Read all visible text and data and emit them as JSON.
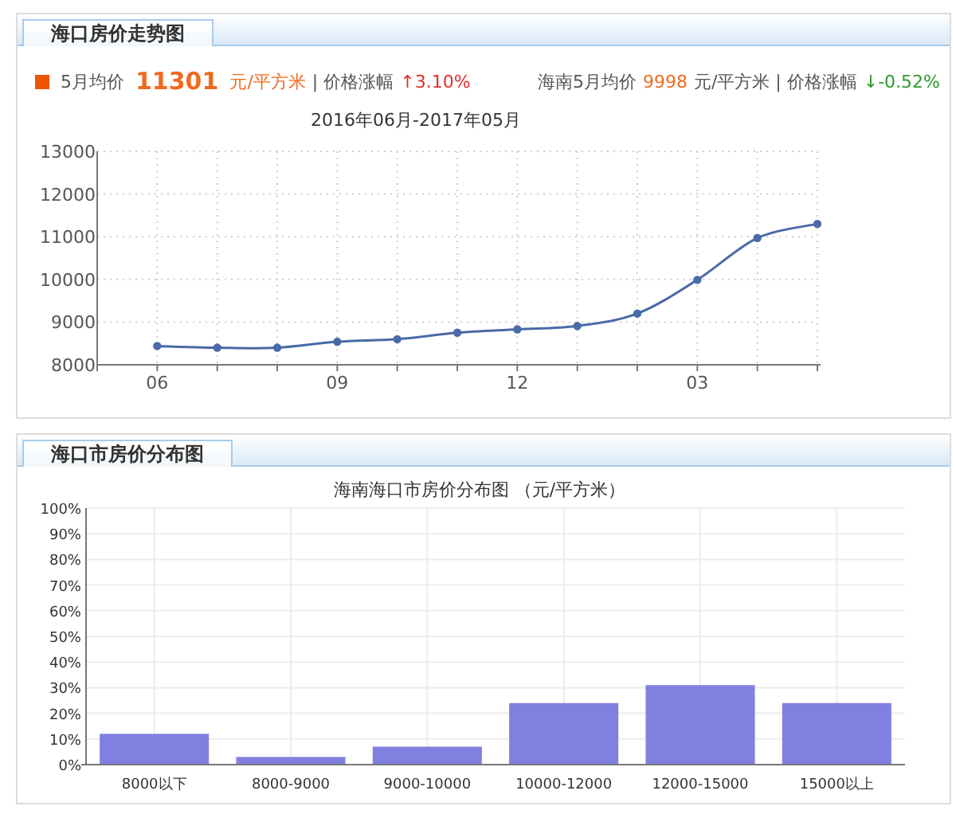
{
  "trend_panel": {
    "tab": "海口房价走势图",
    "summary": {
      "label": "5月均价",
      "price": "11301",
      "unit": "元/平方米",
      "change_label": "| 价格涨幅",
      "change": "↑3.10%"
    },
    "regional_summary": {
      "label": "海南5月均价",
      "price": "9998",
      "unit_and_change_label": "元/平方米 | 价格涨幅",
      "change": "↓-0.52%"
    },
    "chart_data": {
      "type": "line",
      "title": "2016年06月-2017年05月",
      "categories": [
        "06",
        null,
        null,
        "09",
        null,
        null,
        "12",
        null,
        null,
        "03",
        null,
        null
      ],
      "grid": true,
      "series": [
        {
          "color": "#4a6aa8",
          "marker": "circle",
          "values": [
            8440,
            8400,
            8400,
            8540,
            8600,
            8750,
            8830,
            8910,
            9200,
            9990,
            10970,
            11300
          ]
        }
      ],
      "ylim": [
        8000,
        13000
      ],
      "yticks": [
        8000,
        9000,
        10000,
        11000,
        12000,
        13000
      ]
    }
  },
  "distribution_panel": {
    "tab": "海口市房价分布图",
    "chart_data": {
      "type": "bar",
      "title": "海南海口市房价分布图 （元/平方米）",
      "categories": [
        "8000以下",
        "8000-9000",
        "9000-10000",
        "10000-12000",
        "12000-15000",
        "15000以上"
      ],
      "series": [
        {
          "color": "#8080e0",
          "values": [
            12,
            3,
            7,
            24,
            31,
            24
          ]
        }
      ],
      "grid": true,
      "ylim": [
        0,
        100
      ],
      "yticks": [
        {
          "value": 0,
          "label": "0%"
        },
        {
          "value": 10,
          "label": "10%"
        },
        {
          "value": 20,
          "label": "20%"
        },
        {
          "value": 30,
          "label": "30%"
        },
        {
          "value": 40,
          "label": "40%"
        },
        {
          "value": 50,
          "label": "50%"
        },
        {
          "value": 60,
          "label": "60%"
        },
        {
          "value": 70,
          "label": "70%"
        },
        {
          "value": 80,
          "label": "80%"
        },
        {
          "value": 90,
          "label": "90%"
        },
        {
          "value": 100,
          "label": "100%"
        }
      ]
    }
  }
}
